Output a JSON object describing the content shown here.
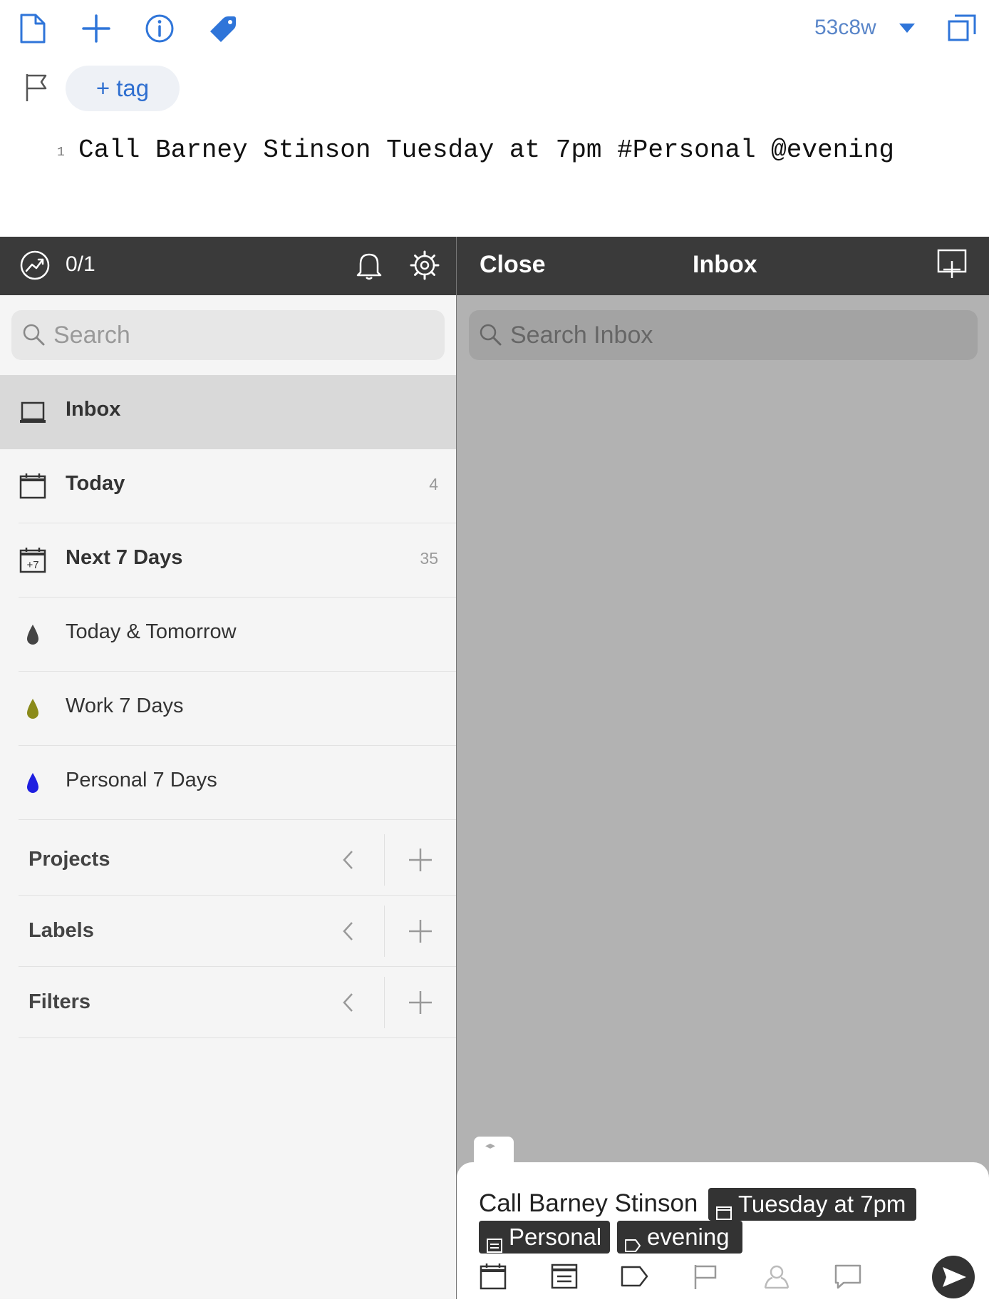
{
  "editor": {
    "version_label": "53c8w",
    "tag_button_label": "+ tag",
    "line_number": "1",
    "line_text": "Call Barney Stinson Tuesday at 7pm #Personal @evening",
    "toolbar_icons": [
      "document-icon",
      "plus-icon",
      "info-icon",
      "tag-icon",
      "expand-window-icon",
      "flag-icon"
    ],
    "accent_color": "#2f75d9"
  },
  "left_header": {
    "progress": "0/1",
    "icons": [
      "productivity-icon",
      "bell-icon",
      "settings-icon"
    ]
  },
  "sidebar": {
    "search_placeholder": "Search",
    "items": [
      {
        "label": "Inbox",
        "count": "",
        "icon": "inbox-icon",
        "selected": true
      },
      {
        "label": "Today",
        "count": "4",
        "icon": "calendar-icon"
      },
      {
        "label": "Next 7 Days",
        "count": "35",
        "icon": "calendar-plus7-icon",
        "icon_text": "+7"
      },
      {
        "label": "Today & Tomorrow",
        "count": "",
        "icon": "filter-drop-icon",
        "color": "#444444"
      },
      {
        "label": "Work 7 Days",
        "count": "",
        "icon": "filter-drop-icon",
        "color": "#8a8a1a"
      },
      {
        "label": "Personal 7 Days",
        "count": "",
        "icon": "filter-drop-icon",
        "color": "#1f1fe0"
      }
    ],
    "sections": [
      {
        "label": "Projects"
      },
      {
        "label": "Labels"
      },
      {
        "label": "Filters"
      }
    ]
  },
  "right_header": {
    "close_label": "Close",
    "title": "Inbox",
    "search_placeholder": "Search Inbox"
  },
  "quick_add": {
    "handle_label": "◂▸",
    "task_text": "Call Barney Stinson",
    "date_chip": "Tuesday at 7pm",
    "project_chip": "Personal",
    "label_chip": "evening",
    "tool_icons": [
      "calendar-icon",
      "project-icon",
      "label-icon",
      "flag-icon",
      "assign-icon",
      "comment-icon",
      "send-icon"
    ]
  }
}
